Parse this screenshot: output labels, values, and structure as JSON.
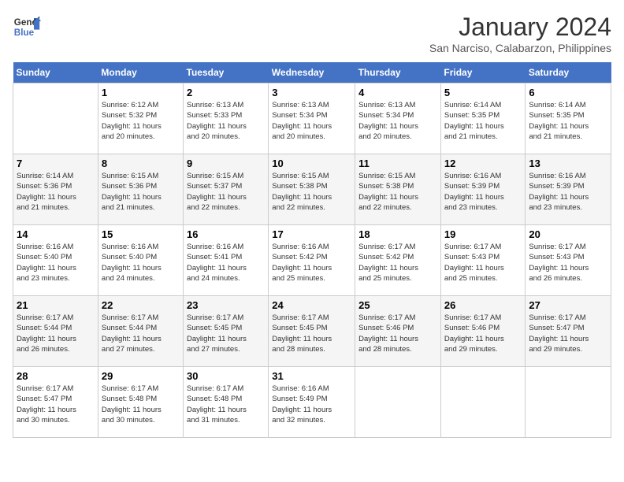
{
  "header": {
    "logo_line1": "General",
    "logo_line2": "Blue",
    "title": "January 2024",
    "subtitle": "San Narciso, Calabarzon, Philippines"
  },
  "columns": [
    "Sunday",
    "Monday",
    "Tuesday",
    "Wednesday",
    "Thursday",
    "Friday",
    "Saturday"
  ],
  "weeks": [
    [
      {
        "day": "",
        "info": ""
      },
      {
        "day": "1",
        "info": "Sunrise: 6:12 AM\nSunset: 5:32 PM\nDaylight: 11 hours\nand 20 minutes."
      },
      {
        "day": "2",
        "info": "Sunrise: 6:13 AM\nSunset: 5:33 PM\nDaylight: 11 hours\nand 20 minutes."
      },
      {
        "day": "3",
        "info": "Sunrise: 6:13 AM\nSunset: 5:34 PM\nDaylight: 11 hours\nand 20 minutes."
      },
      {
        "day": "4",
        "info": "Sunrise: 6:13 AM\nSunset: 5:34 PM\nDaylight: 11 hours\nand 20 minutes."
      },
      {
        "day": "5",
        "info": "Sunrise: 6:14 AM\nSunset: 5:35 PM\nDaylight: 11 hours\nand 21 minutes."
      },
      {
        "day": "6",
        "info": "Sunrise: 6:14 AM\nSunset: 5:35 PM\nDaylight: 11 hours\nand 21 minutes."
      }
    ],
    [
      {
        "day": "7",
        "info": "Sunrise: 6:14 AM\nSunset: 5:36 PM\nDaylight: 11 hours\nand 21 minutes."
      },
      {
        "day": "8",
        "info": "Sunrise: 6:15 AM\nSunset: 5:36 PM\nDaylight: 11 hours\nand 21 minutes."
      },
      {
        "day": "9",
        "info": "Sunrise: 6:15 AM\nSunset: 5:37 PM\nDaylight: 11 hours\nand 22 minutes."
      },
      {
        "day": "10",
        "info": "Sunrise: 6:15 AM\nSunset: 5:38 PM\nDaylight: 11 hours\nand 22 minutes."
      },
      {
        "day": "11",
        "info": "Sunrise: 6:15 AM\nSunset: 5:38 PM\nDaylight: 11 hours\nand 22 minutes."
      },
      {
        "day": "12",
        "info": "Sunrise: 6:16 AM\nSunset: 5:39 PM\nDaylight: 11 hours\nand 23 minutes."
      },
      {
        "day": "13",
        "info": "Sunrise: 6:16 AM\nSunset: 5:39 PM\nDaylight: 11 hours\nand 23 minutes."
      }
    ],
    [
      {
        "day": "14",
        "info": "Sunrise: 6:16 AM\nSunset: 5:40 PM\nDaylight: 11 hours\nand 23 minutes."
      },
      {
        "day": "15",
        "info": "Sunrise: 6:16 AM\nSunset: 5:40 PM\nDaylight: 11 hours\nand 24 minutes."
      },
      {
        "day": "16",
        "info": "Sunrise: 6:16 AM\nSunset: 5:41 PM\nDaylight: 11 hours\nand 24 minutes."
      },
      {
        "day": "17",
        "info": "Sunrise: 6:16 AM\nSunset: 5:42 PM\nDaylight: 11 hours\nand 25 minutes."
      },
      {
        "day": "18",
        "info": "Sunrise: 6:17 AM\nSunset: 5:42 PM\nDaylight: 11 hours\nand 25 minutes."
      },
      {
        "day": "19",
        "info": "Sunrise: 6:17 AM\nSunset: 5:43 PM\nDaylight: 11 hours\nand 25 minutes."
      },
      {
        "day": "20",
        "info": "Sunrise: 6:17 AM\nSunset: 5:43 PM\nDaylight: 11 hours\nand 26 minutes."
      }
    ],
    [
      {
        "day": "21",
        "info": "Sunrise: 6:17 AM\nSunset: 5:44 PM\nDaylight: 11 hours\nand 26 minutes."
      },
      {
        "day": "22",
        "info": "Sunrise: 6:17 AM\nSunset: 5:44 PM\nDaylight: 11 hours\nand 27 minutes."
      },
      {
        "day": "23",
        "info": "Sunrise: 6:17 AM\nSunset: 5:45 PM\nDaylight: 11 hours\nand 27 minutes."
      },
      {
        "day": "24",
        "info": "Sunrise: 6:17 AM\nSunset: 5:45 PM\nDaylight: 11 hours\nand 28 minutes."
      },
      {
        "day": "25",
        "info": "Sunrise: 6:17 AM\nSunset: 5:46 PM\nDaylight: 11 hours\nand 28 minutes."
      },
      {
        "day": "26",
        "info": "Sunrise: 6:17 AM\nSunset: 5:46 PM\nDaylight: 11 hours\nand 29 minutes."
      },
      {
        "day": "27",
        "info": "Sunrise: 6:17 AM\nSunset: 5:47 PM\nDaylight: 11 hours\nand 29 minutes."
      }
    ],
    [
      {
        "day": "28",
        "info": "Sunrise: 6:17 AM\nSunset: 5:47 PM\nDaylight: 11 hours\nand 30 minutes."
      },
      {
        "day": "29",
        "info": "Sunrise: 6:17 AM\nSunset: 5:48 PM\nDaylight: 11 hours\nand 30 minutes."
      },
      {
        "day": "30",
        "info": "Sunrise: 6:17 AM\nSunset: 5:48 PM\nDaylight: 11 hours\nand 31 minutes."
      },
      {
        "day": "31",
        "info": "Sunrise: 6:16 AM\nSunset: 5:49 PM\nDaylight: 11 hours\nand 32 minutes."
      },
      {
        "day": "",
        "info": ""
      },
      {
        "day": "",
        "info": ""
      },
      {
        "day": "",
        "info": ""
      }
    ]
  ]
}
